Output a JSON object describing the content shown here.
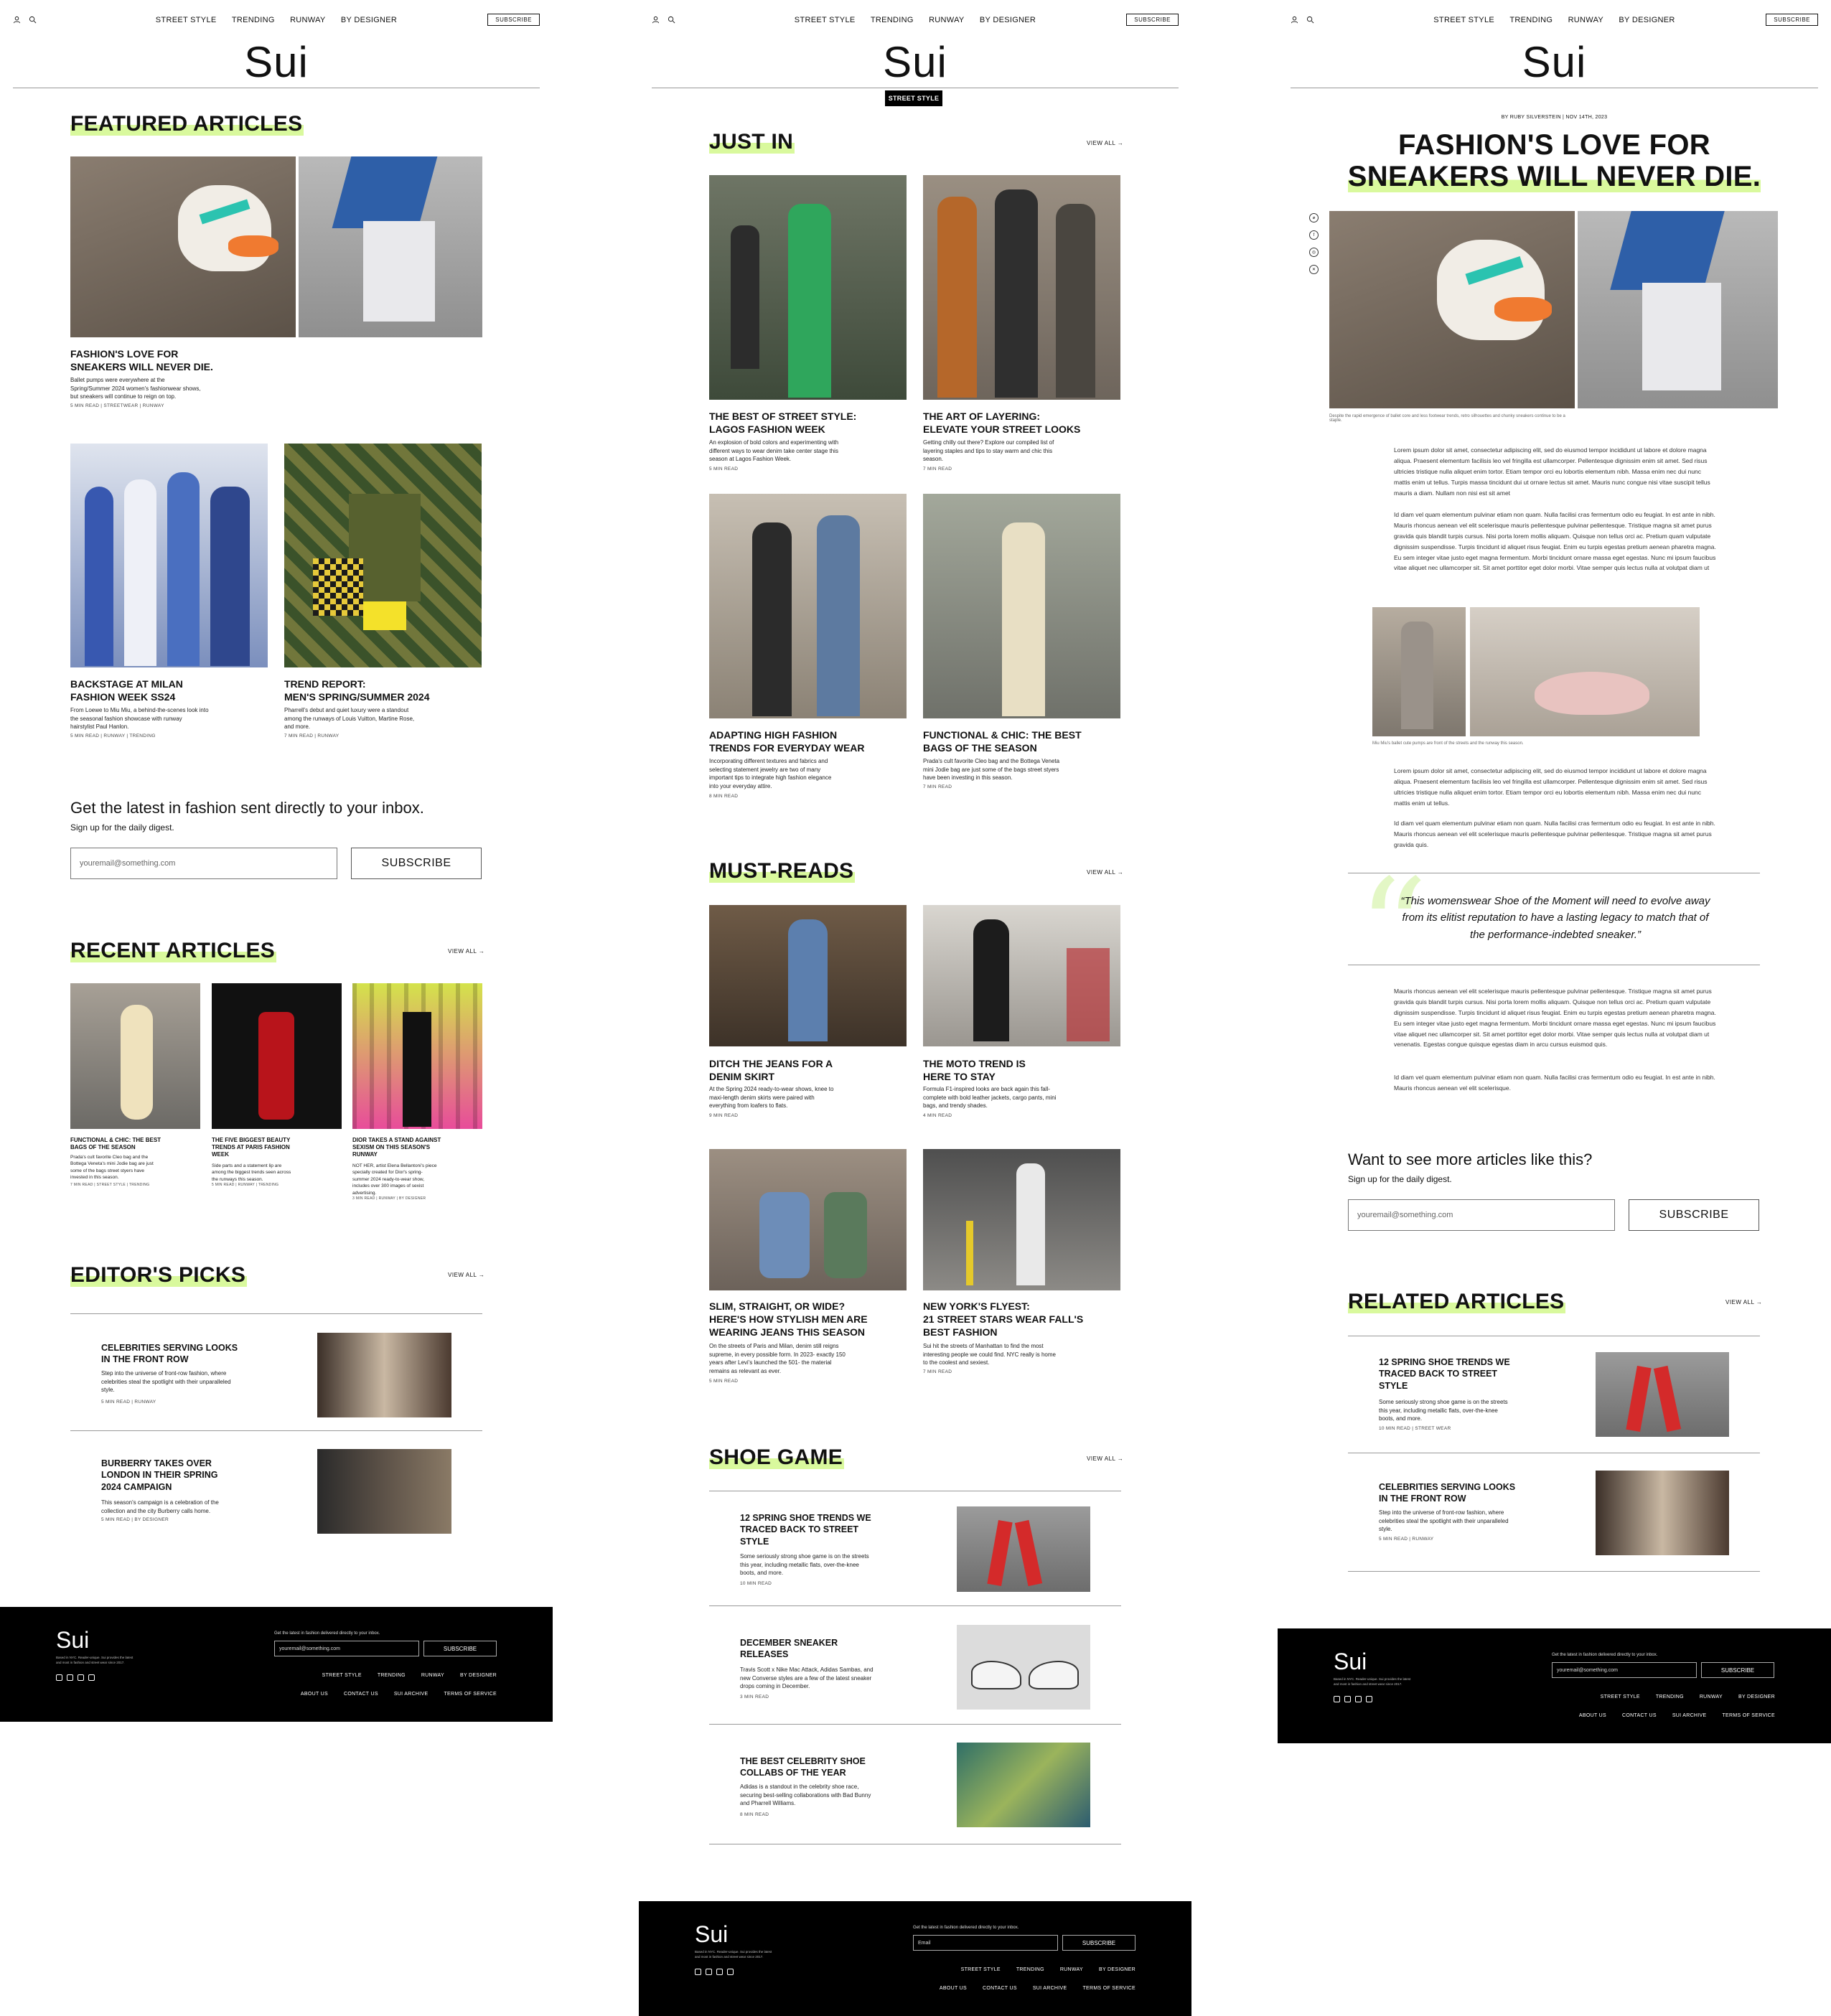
{
  "header": {
    "logo": "Sui",
    "nav": [
      "STREET STYLE",
      "TRENDING",
      "RUNWAY",
      "BY DESIGNER"
    ],
    "subscribe_label": "SUBSCRIBE"
  },
  "home": {
    "featured_heading": "FEATURED ARTICLES",
    "featured": [
      {
        "title": "FASHION'S LOVE FOR\nSNEAKERS WILL NEVER DIE.",
        "excerpt": "Ballet pumps were everywhere at the\nSpring/Summer 2024 women's fashionwear shows,\nbut sneakers will continue to reign on top.",
        "meta": "5 MIN READ | STREETWEAR | RUNWAY"
      },
      {
        "title": "BACKSTAGE AT MILAN\nFASHION WEEK SS24",
        "excerpt": "From Loewe to Miu Miu, a behind-the-scenes look into\nthe seasonal fashion showcase with runway\nhairstylist Paul Hanlon.",
        "meta": "5 MIN READ | RUNWAY | TRENDING"
      },
      {
        "title": "TREND REPORT:\nMEN'S SPRING/SUMMER 2024",
        "excerpt": "Pharrell's debut and quiet luxury were a standout\namong the runways of Louis Vuitton, Martine Rose,\nand more.",
        "meta": "7 MIN READ | RUNWAY"
      }
    ],
    "newsletter_heading": "Get the latest in fashion sent directly to your inbox.",
    "newsletter_sub": "Sign up for the daily digest.",
    "email_placeholder": "youremail@something.com",
    "subscribe_button": "SUBSCRIBE",
    "recent_heading": "RECENT ARTICLES",
    "view_all": "VIEW ALL →",
    "recent": [
      {
        "title": "FUNCTIONAL & CHIC: THE BEST\nBAGS OF THE SEASON",
        "excerpt": "Prada's cult favorite Cleo bag and the\nBottega Veneta's mini Jodie bag are just\nsome of the bags street styers have\ninvested in this season.",
        "meta": "7 MIN READ | STREET STYLE | TRENDING"
      },
      {
        "title": "THE FIVE BIGGEST BEAUTY\nTRENDS AT PARIS FASHION\nWEEK",
        "excerpt": "Side parts and a statement lip are\namong the biggest trends seen across\nthe runways this season.",
        "meta": "5 MIN READ | RUNWAY | TRENDING"
      },
      {
        "title": "DIOR TAKES A STAND AGAINST\nSEXISM ON THIS SEASON'S\nRUNWAY",
        "excerpt": "NOT HER, artist Elena Bellantoni's piece\nspecially created for Dior's spring-\nsummer 2024 ready-to-wear show,\nincludes over 300 images of sexist\nadvertising.",
        "meta": "3 MIN READ | RUNWAY | BY DESIGNER"
      }
    ],
    "editors_heading": "EDITOR'S PICKS",
    "editors": [
      {
        "title": "CELEBRITIES SERVING LOOKS\nIN THE FRONT ROW",
        "excerpt": "Step into the universe of front-row fashion, where\ncelebrities steal the spotlight with their unparalleled\nstyle.",
        "meta": "5 MIN READ | RUNWAY"
      },
      {
        "title": "BURBERRY TAKES OVER\nLONDON IN THEIR SPRING\n2024 CAMPAIGN",
        "excerpt": "This season's campaign is a celebration of the\ncollection and the city Burberry calls home.",
        "meta": "5 MIN READ | BY DESIGNER"
      }
    ]
  },
  "street": {
    "category_tag": "STREET STYLE",
    "justin_heading": "JUST IN",
    "justin": [
      {
        "title": "THE BEST OF STREET STYLE:\nLAGOS FASHION WEEK",
        "excerpt": "An explosion of bold colors and experimenting with\ndifferent ways to wear denim take center stage this\nseason at Lagos Fashion Week.",
        "meta": "5 MIN READ"
      },
      {
        "title": "THE ART OF LAYERING:\nELEVATE YOUR STREET LOOKS",
        "excerpt": "Getting chilly out there? Explore our compiled list of\nlayering staples and tips to stay warm and chic this\nseason.",
        "meta": "7 MIN READ"
      },
      {
        "title": "ADAPTING HIGH FASHION\nTRENDS FOR EVERYDAY WEAR",
        "excerpt": "Incorporating different textures and fabrics and\nselecting statement jewelry are two of many\nimportant tips to integrate high fashion elegance\ninto your everyday attire.",
        "meta": "8 MIN READ"
      },
      {
        "title": "FUNCTIONAL & CHIC: THE BEST\nBAGS OF THE SEASON",
        "excerpt": "Prada's cult favorite Cleo bag and the Bottega Veneta\nmini Jodie bag are just some of the bags street styers\nhave been investing in this season.",
        "meta": "7 MIN READ"
      }
    ],
    "mustreads_heading": "MUST-READS",
    "mustreads": [
      {
        "title": "DITCH THE JEANS FOR A\nDENIM SKIRT",
        "excerpt": "At the Spring 2024 ready-to-wear shows, knee to\nmaxi-length denim skirts were paired with\neverything from loafers to flats.",
        "meta": "9 MIN READ"
      },
      {
        "title": "THE MOTO TREND IS\nHERE TO STAY",
        "excerpt": "Formula F1-inspired looks are back again this fall-\ncomplete with bold leather jackets, cargo pants, mini\nbags, and trendy shades.",
        "meta": "4 MIN READ"
      },
      {
        "title": "SLIM, STRAIGHT, OR WIDE?\nHERE'S HOW STYLISH MEN ARE\nWEARING JEANS THIS SEASON",
        "excerpt": "On the streets of Paris and Milan, denim still reigns\nsupreme, in every possible form. In 2023- exactly 150\nyears after Levi's launched the 501- the material\nremains as relevant as ever.",
        "meta": "5 MIN READ"
      },
      {
        "title": "NEW YORK'S FLYEST:\n21 STREET STARS WEAR FALL'S\nBEST FASHION",
        "excerpt": "Sui hit the streets of Manhattan to find the most\ninteresting people we could find. NYC really is home\nto the coolest and sexiest.",
        "meta": "7 MIN READ"
      }
    ],
    "shoe_heading": "SHOE GAME",
    "shoes": [
      {
        "title": "12 SPRING SHOE TRENDS WE\nTRACED BACK TO STREET\nSTYLE",
        "excerpt": "Some seriously strong shoe game is on the streets\nthis year, including metallic flats, over-the-knee\nboots, and more.",
        "meta": "10 MIN READ"
      },
      {
        "title": "DECEMBER SNEAKER\nRELEASES",
        "excerpt": "Travis Scott x Nike Mac Attack, Adidas Sambas, and\nnew Converse styles are a few of the latest sneaker\ndrops coming in December.",
        "meta": "3 MIN READ"
      },
      {
        "title": "THE BEST CELEBRITY SHOE\nCOLLABS OF THE YEAR",
        "excerpt": "Adidas is a standout in the celebrity shoe race,\nsecuring best-selling collaborations with Bad Bunny\nand Pharrell Williams.",
        "meta": "8 MIN READ"
      }
    ]
  },
  "article": {
    "byline": "BY RUBY SILVERSTEIN | NOV 14TH, 2023",
    "title_line1": "FASHION'S LOVE FOR",
    "title_line2": "SNEAKERS WILL NEVER DIE.",
    "caption1": "Despite the rapid emergence of ballet core and less footwear trends, retro silhouettes and chunky sneakers continue to be a staple.",
    "para1": "Lorem ipsum dolor sit amet, consectetur adipiscing elit, sed do eiusmod tempor incididunt ut labore et dolore magna aliqua. Praesent elementum facilisis leo vel fringilla est ullamcorper. Pellentesque dignissim enim sit amet. Sed risus ultricies tristique nulla aliquet enim tortor. Etiam tempor orci eu lobortis elementum nibh. Massa enim nec dui nunc mattis enim ut tellus. Turpis massa tincidunt dui ut ornare lectus sit amet. Mauris nunc congue nisi vitae suscipit tellus mauris a diam. Nullam non nisi est sit amet",
    "para2": "Id diam vel quam elementum pulvinar etiam non quam. Nulla facilisi cras fermentum odio eu feugiat. In est ante in nibh. Mauris rhoncus aenean vel elit scelerisque mauris pellentesque pulvinar pellentesque. Tristique magna sit amet purus gravida quis blandit turpis cursus. Nisi porta lorem mollis aliquam. Quisque non tellus orci ac. Pretium quam vulputate dignissim suspendisse. Turpis tincidunt id aliquet risus feugiat. Enim eu turpis egestas pretium aenean pharetra magna. Eu sem integer vitae justo eget magna fermentum. Morbi tincidunt ornare massa eget egestas. Nunc mi ipsum faucibus vitae aliquet nec ullamcorper sit. Sit amet porttitor eget dolor morbi. Vitae semper quis lectus nulla at volutpat diam ut",
    "caption2": "Miu Miu's ballet cute pumps are front of the streets and the runway this season.",
    "para3": "Lorem ipsum dolor sit amet, consectetur adipiscing elit, sed do eiusmod tempor incididunt ut labore et dolore magna aliqua. Praesent elementum facilisis leo vel fringilla est ullamcorper. Pellentesque dignissim enim sit amet. Sed risus ultricies tristique nulla aliquet enim tortor. Etiam tempor orci eu lobortis elementum nibh. Massa enim nec dui nunc mattis enim ut tellus.",
    "para4": "Id diam vel quam elementum pulvinar etiam non quam. Nulla facilisi cras fermentum odio eu feugiat. In est ante in nibh. Mauris rhoncus aenean vel elit scelerisque mauris pellentesque pulvinar pellentesque. Tristique magna sit amet purus gravida quis.",
    "quote": "“This womenswear Shoe of the Moment will need to evolve away from its elitist reputation to have a lasting legacy to match that of the performance-indebted sneaker.”",
    "para5": "Mauris rhoncus aenean vel elit scelerisque mauris pellentesque pulvinar pellentesque. Tristique magna sit amet purus gravida quis blandit turpis cursus. Nisi porta lorem mollis aliquam. Quisque non tellus orci ac. Pretium quam vulputate dignissim suspendisse. Turpis tincidunt id aliquet risus feugiat. Enim eu turpis egestas pretium aenean pharetra magna. Eu sem integer vitae justo eget magna fermentum. Morbi tincidunt ornare massa eget egestas. Nunc mi ipsum faucibus vitae aliquet nec ullamcorper sit. Sit amet porttitor eget dolor morbi. Vitae semper quis lectus nulla at volutpat diam ut venenatis. Egestas congue quisque egestas diam in arcu cursus euismod quis.",
    "para6": "Id diam vel quam elementum pulvinar etiam non quam. Nulla facilisi cras fermentum odio eu feugiat. In est ante in nibh. Mauris rhoncus aenean vel elit scelerisque.",
    "more_heading": "Want to see more articles like this?",
    "more_sub": "Sign up for the daily digest.",
    "related_heading": "RELATED ARTICLES",
    "related": [
      {
        "title": "12 SPRING SHOE TRENDS WE\nTRACED BACK TO STREET\nSTYLE",
        "excerpt": "Some seriously strong shoe game is on the streets\nthis year, including metallic flats, over-the-knee\nboots, and more.",
        "meta": "10 MIN READ | STREET WEAR"
      },
      {
        "title": "CELEBRITIES SERVING LOOKS\nIN THE FRONT ROW",
        "excerpt": "Step into the universe of front-row fashion, where\ncelebrities steal the spotlight with their unparalleled\nstyle.",
        "meta": "5 MIN READ | RUNWAY"
      }
    ]
  },
  "footer": {
    "logo": "Sui",
    "tagline": "Based in NYC. Reader-unique. Sui provides the latest\nand most in fashion and street wear since 2017.",
    "prompt_a": "Get the latest in fashion delivered directly to your inbox.",
    "prompt_b": "Get the latest in fashion delivered directly to your inbox.",
    "email_placeholder": "youremail@something.com",
    "email_placeholder_b": "Email",
    "subscribe": "SUBSCRIBE",
    "nav1": [
      "STREET STYLE",
      "TRENDING",
      "RUNWAY",
      "BY DESIGNER"
    ],
    "nav2": [
      "ABOUT US",
      "CONTACT US",
      "SUI ARCHIVE",
      "TERMS OF SERVICE"
    ]
  },
  "colors": {
    "accent": "#d9f99d",
    "dark": "#000000"
  }
}
